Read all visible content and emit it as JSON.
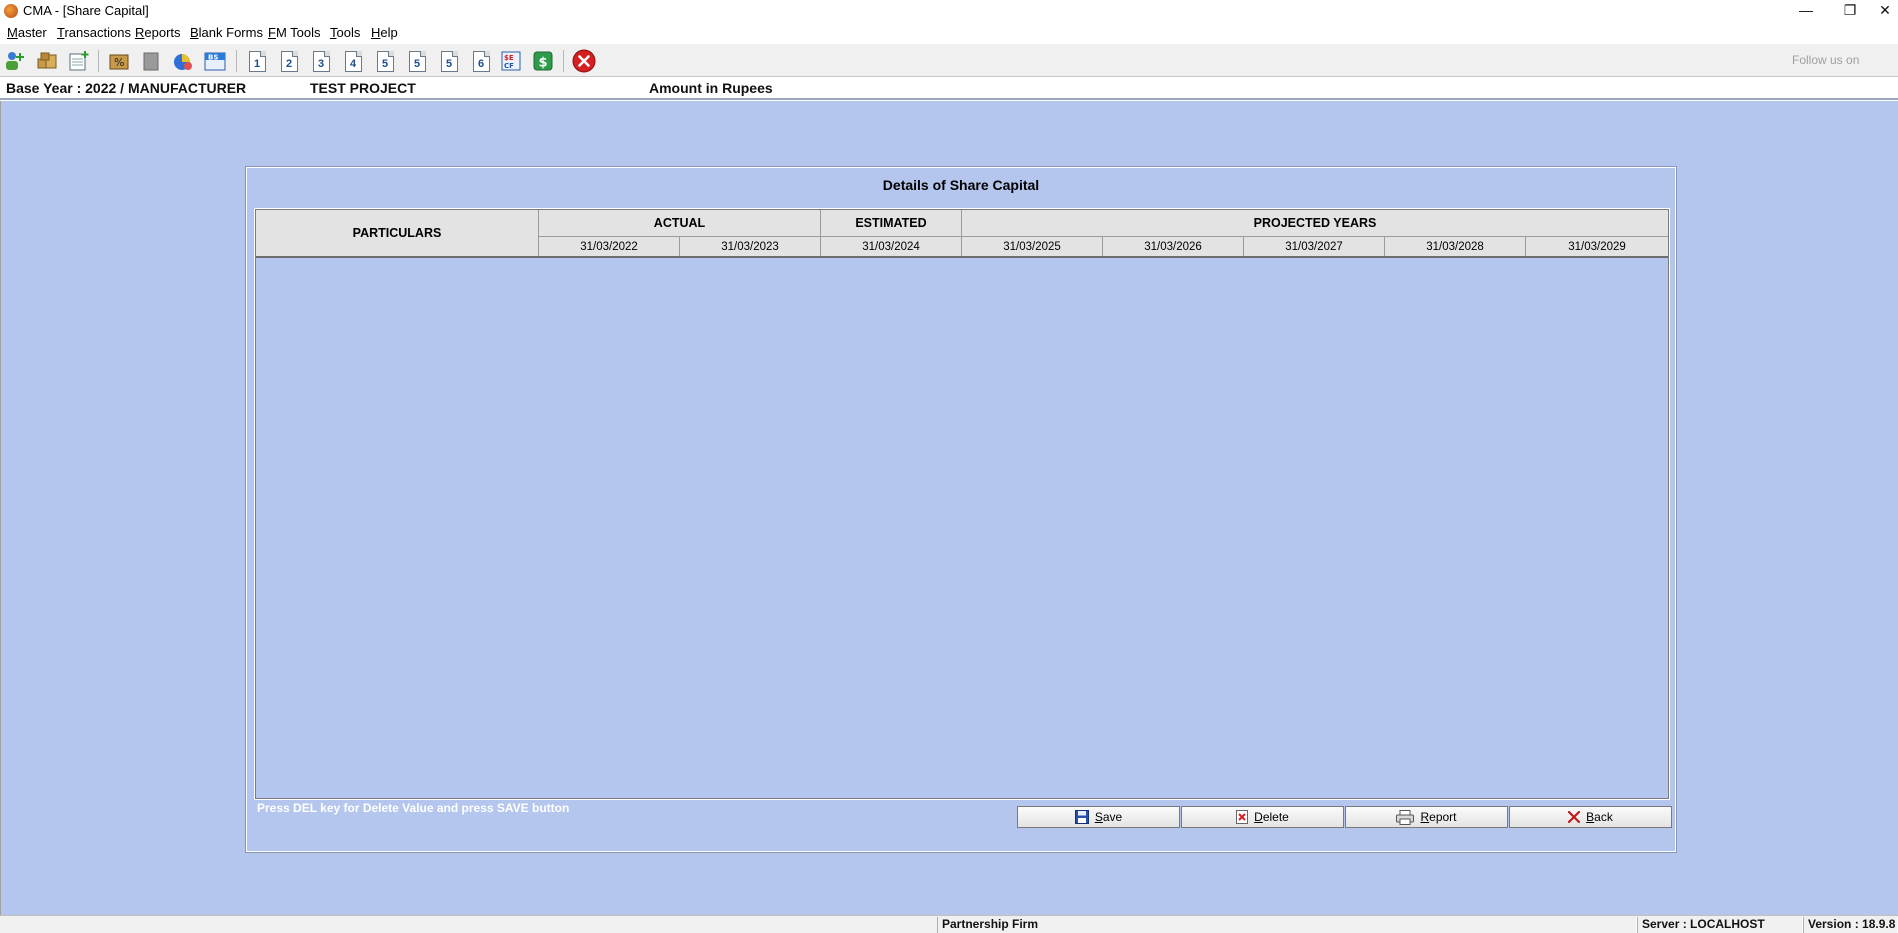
{
  "window": {
    "title": "CMA - [Share Capital]",
    "min_glyph": "—",
    "max_glyph": "❐",
    "close_glyph": "✕"
  },
  "menu": [
    {
      "accel": "M",
      "rest": "aster"
    },
    {
      "accel": "T",
      "rest": "ransactions"
    },
    {
      "accel": "R",
      "rest": "eports"
    },
    {
      "accel": "B",
      "rest": "lank Forms"
    },
    {
      "accel": "F",
      "rest": "M Tools",
      "prefix": ""
    },
    {
      "accel": "T",
      "rest": "ools"
    },
    {
      "accel": "H",
      "rest": "elp"
    }
  ],
  "toolbar": {
    "number_buttons": [
      "1",
      "2",
      "3",
      "4",
      "5",
      "5",
      "5",
      "6"
    ],
    "follow_us": "Follow us on"
  },
  "infobar": {
    "base_year": "Base Year : 2022 / MANUFACTURER",
    "project": "TEST PROJECT",
    "amount": "Amount in Rupees"
  },
  "panel": {
    "title": "Details of Share Capital",
    "grid": {
      "particulars": "PARTICULARS",
      "groups": {
        "actual": "ACTUAL",
        "estimated": "ESTIMATED",
        "projected": "PROJECTED YEARS"
      },
      "dates": [
        "31/03/2022",
        "31/03/2023",
        "31/03/2024",
        "31/03/2025",
        "31/03/2026",
        "31/03/2027",
        "31/03/2028",
        "31/03/2029"
      ]
    },
    "hint": "Press DEL key for Delete Value and press SAVE button",
    "buttons": {
      "save": "Save",
      "delete": "Delete",
      "report": "Report",
      "back": "Back"
    }
  },
  "status": {
    "firm": "Partnership Firm",
    "server": "Server : LOCALHOST",
    "version": "Version : 18.9.8"
  }
}
